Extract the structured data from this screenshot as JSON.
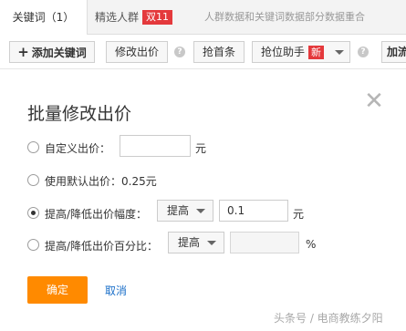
{
  "tabs": {
    "keywords": "关键词（1）",
    "crowd": "精选人群",
    "crowd_badge": "双11",
    "notice": "人群数据和关键词数据部分数据重合"
  },
  "toolbar": {
    "add_keyword": "添加关键词",
    "edit_bid": "修改出价",
    "grab_first": "抢首条",
    "rank_helper": "抢位助手",
    "rank_helper_badge": "新",
    "more": "加流",
    "help_glyph": "?"
  },
  "dialog": {
    "title": "批量修改出价",
    "close_glyph": "✕",
    "options": [
      {
        "label": "自定义出价：",
        "selected": false
      },
      {
        "label": "使用默认出价：0.25元",
        "selected": false
      },
      {
        "label": "提高/降低出价幅度：",
        "selected": true
      },
      {
        "label": "提高/降低出价百分比：",
        "selected": false
      }
    ],
    "custom_bid": {
      "value": "",
      "unit": "元"
    },
    "amount": {
      "direction": "提高",
      "value": "0.1",
      "unit": "元"
    },
    "percent": {
      "direction": "提高",
      "value": "",
      "unit": "%"
    },
    "ok": "确定",
    "cancel": "取消"
  },
  "watermark": "头条号 / 电商教练夕阳",
  "colors": {
    "accent_orange": "#ff8a00",
    "badge_red": "#e4393c",
    "link_blue": "#1a6fc9"
  }
}
